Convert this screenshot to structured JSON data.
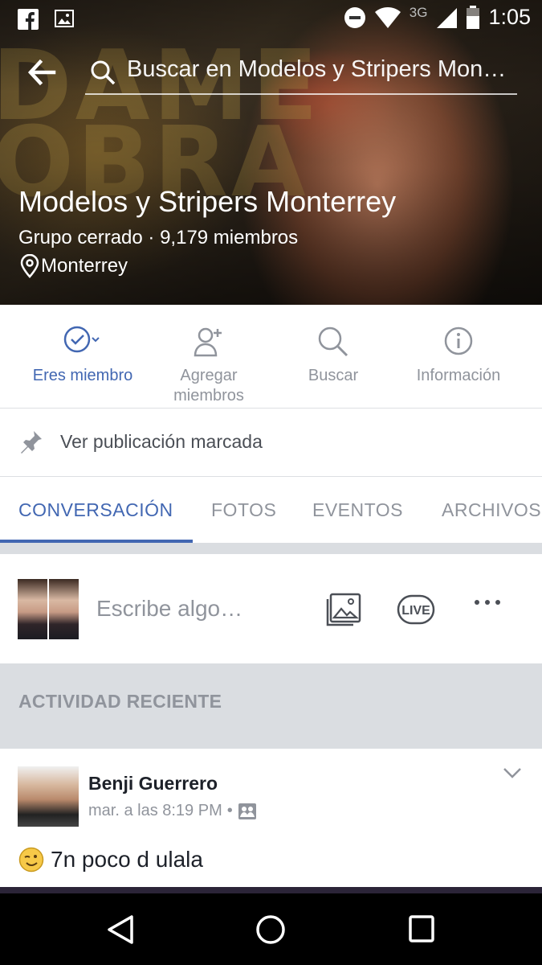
{
  "status_bar": {
    "network": "3G",
    "time": "1:05"
  },
  "header": {
    "search_placeholder": "Buscar en Modelos y Stripers Mon…",
    "group_name": "Modelos y Stripers Monterrey",
    "group_subtitle": "Grupo cerrado · 9,179 miembros",
    "location": "Monterrey",
    "cover_letters": "DAME\nOBRA"
  },
  "actions": [
    {
      "label": "Eres miembro",
      "icon": "check-circle-icon",
      "active": true
    },
    {
      "label": "Agregar\nmiembros",
      "icon": "add-person-icon",
      "active": false
    },
    {
      "label": "Buscar",
      "icon": "search-icon",
      "active": false
    },
    {
      "label": "Información",
      "icon": "info-icon",
      "active": false
    }
  ],
  "pinned": {
    "label": "Ver publicación marcada"
  },
  "tabs": [
    {
      "label": "CONVERSACIÓN",
      "active": true
    },
    {
      "label": "FOTOS",
      "active": false
    },
    {
      "label": "EVENTOS",
      "active": false
    },
    {
      "label": "ARCHIVOS",
      "active": false
    }
  ],
  "composer": {
    "placeholder": "Escribe algo…",
    "live_label": "LIVE"
  },
  "recent_activity": {
    "heading": "ACTIVIDAD RECIENTE"
  },
  "post": {
    "author": "Benji Guerrero",
    "time": "mar. a las 8:19 PM",
    "text": "7n poco d ulala"
  },
  "colors": {
    "accent": "#4267b2",
    "muted": "#90949c",
    "divider": "#dadde1"
  }
}
